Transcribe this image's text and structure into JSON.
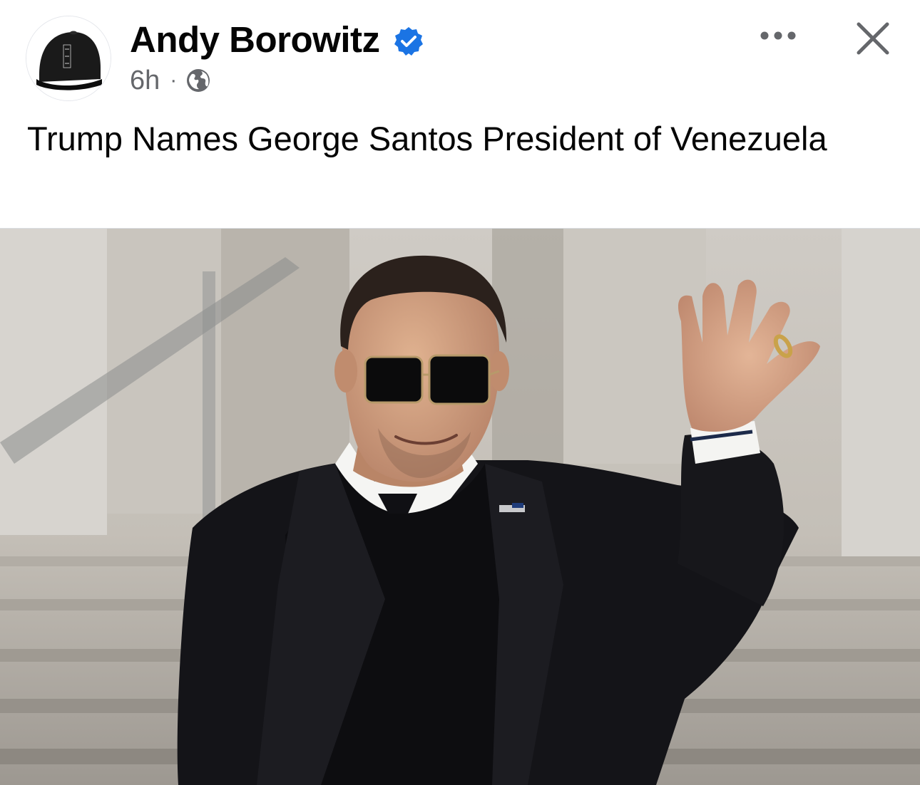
{
  "post": {
    "author": "Andy Borowitz",
    "verified_icon": "verified-badge-icon",
    "time": "6h",
    "separator": "·",
    "audience_icon": "globe-icon",
    "text": "Trump Names George Santos President of Venezuela",
    "avatar_hat_text": "TBR"
  },
  "actions": {
    "more_icon": "more-options-icon",
    "close_icon": "close-icon"
  },
  "colors": {
    "verified": "#1b74e4",
    "secondary_text": "#65676b",
    "primary_text": "#050505"
  }
}
